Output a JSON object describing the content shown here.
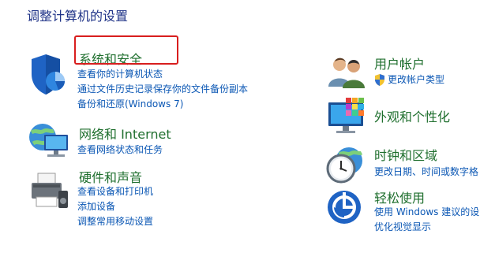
{
  "page": {
    "title": "调整计算机的设置"
  },
  "left": [
    {
      "icon": "security-shield-icon",
      "title": "系统和安全",
      "links": [
        "查看你的计算机状态",
        "通过文件历史记录保存你的文件备份副本",
        "备份和还原(Windows 7)"
      ]
    },
    {
      "icon": "network-globe-icon",
      "title": "网络和 Internet",
      "links": [
        "查看网络状态和任务"
      ]
    },
    {
      "icon": "printer-speaker-icon",
      "title": "硬件和声音",
      "links": [
        "查看设备和打印机",
        "添加设备",
        "调整常用移动设置"
      ]
    }
  ],
  "right": [
    {
      "icon": "users-icon",
      "title": "用户帐户",
      "links": [
        "更改帐户类型"
      ]
    },
    {
      "icon": "display-palette-icon",
      "title": "外观和个性化",
      "links": []
    },
    {
      "icon": "clock-globe-icon",
      "title": "时钟和区域",
      "links": [
        "更改日期、时间或数字格"
      ]
    },
    {
      "icon": "ease-of-access-icon",
      "title": "轻松使用",
      "links": [
        "使用 Windows 建议的设",
        "优化视觉显示"
      ]
    }
  ],
  "colors": {
    "title": "#1e3287",
    "category": "#1f6f2e",
    "link": "#0b57b4",
    "highlight": "#d81e1e"
  }
}
